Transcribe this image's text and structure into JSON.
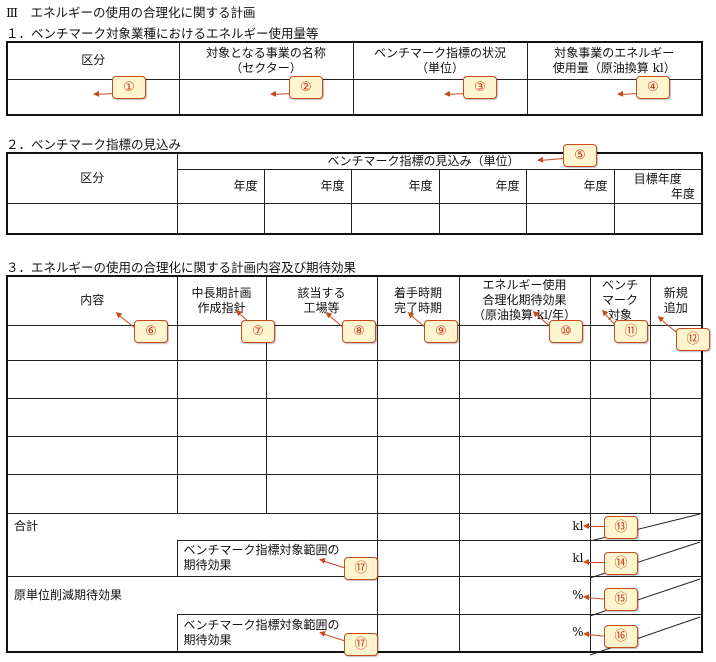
{
  "title": "Ⅲ　エネルギーの使用の合理化に関する計画",
  "section1": {
    "heading": "１．ベンチマーク対象業種におけるエネルギー使用量等",
    "col1": "区分",
    "col2_line1": "対象となる事業の名称",
    "col2_line2": "（セクター）",
    "col3_line1": "ベンチマーク指標の状況",
    "col3_line2": "（単位）",
    "col4_line1": "対象事業のエネルギー",
    "col4_line2": "使用量（原油換算 kl）"
  },
  "section2": {
    "heading": "２．ベンチマーク指標の見込み",
    "col1": "区分",
    "span_header": "ベンチマーク指標の見込み（単位）",
    "years": [
      "年度",
      "年度",
      "年度",
      "年度",
      "年度"
    ],
    "target_line1": "目標年度",
    "target_line2": "年度"
  },
  "section3": {
    "heading": "３．エネルギーの使用の合理化に関する計画内容及び期待効果",
    "col_content": "内容",
    "col_plan_line1": "中長期計画",
    "col_plan_line2": "作成指針",
    "col_factory_line1": "該当する",
    "col_factory_line2": "工場等",
    "col_timing_line1": "着手時期",
    "col_timing_line2": "完了時期",
    "col_effect_line1": "エネルギー使用",
    "col_effect_line2": "合理化期待効果",
    "col_effect_line3": "（原油換算 kl/年）",
    "col_bench_line1": "ベンチ",
    "col_bench_line2": "マーク",
    "col_bench_line3": "対象",
    "col_new_line1": "新規",
    "col_new_line2": "追加",
    "total": "合計",
    "bench_range_line1": "ベンチマーク指標対象範囲の",
    "bench_range_line2": "期待効果",
    "unit_kl": "kl",
    "reduction": "原単位削減期待効果",
    "unit_pct": "%"
  },
  "callouts": [
    "①",
    "②",
    "③",
    "④",
    "⑤",
    "⑥",
    "⑦",
    "⑧",
    "⑨",
    "⑩",
    "⑪",
    "⑫",
    "⑬",
    "⑭",
    "⑮",
    "⑯",
    "⑰",
    "⑰"
  ],
  "colors": {
    "callout_bg": "#fff6cf",
    "callout_border": "#c94a1d",
    "callout_text": "#c0391a"
  }
}
